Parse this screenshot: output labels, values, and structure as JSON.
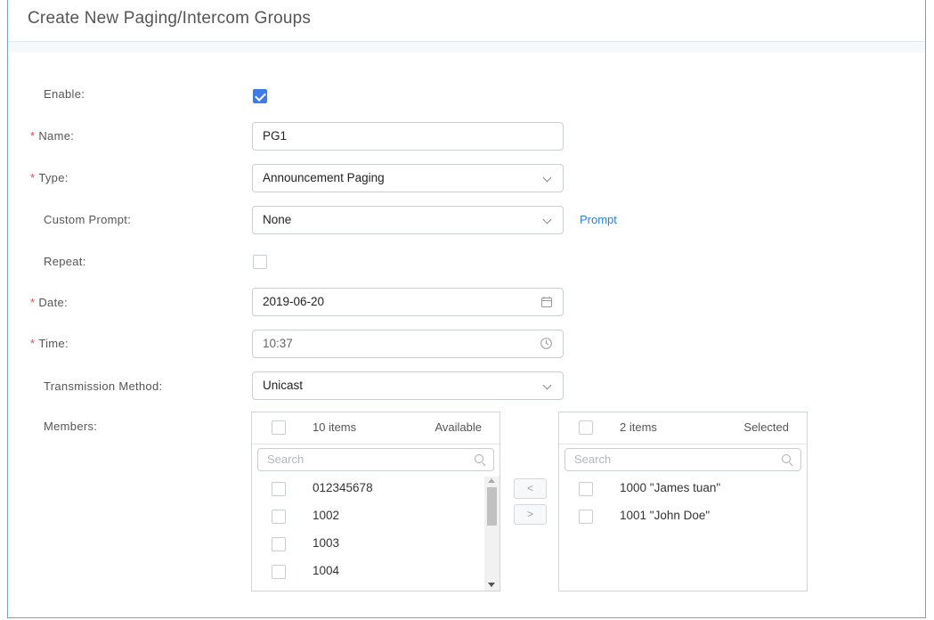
{
  "header": {
    "title": "Create New Paging/Intercom Groups"
  },
  "form": {
    "enable": {
      "label": "Enable:",
      "checked": true
    },
    "name": {
      "label": "Name:",
      "required_mark": "*",
      "value": "PG1"
    },
    "type": {
      "label": "Type:",
      "required_mark": "*",
      "value": "Announcement Paging"
    },
    "custom_prompt": {
      "label": "Custom Prompt:",
      "value": "None",
      "link": "Prompt"
    },
    "repeat": {
      "label": "Repeat:",
      "checked": false
    },
    "date": {
      "label": "Date:",
      "required_mark": "*",
      "value": "2019-06-20"
    },
    "time": {
      "label": "Time:",
      "required_mark": "*",
      "value": "10:37"
    },
    "transmission": {
      "label": "Transmission Method:",
      "value": "Unicast"
    },
    "members": {
      "label": "Members:"
    }
  },
  "available": {
    "count": "10 items",
    "title": "Available",
    "search_placeholder": "Search",
    "items": [
      "012345678",
      "1002",
      "1003",
      "1004"
    ]
  },
  "selected": {
    "count": "2 items",
    "title": "Selected",
    "search_placeholder": "Search",
    "items": [
      "1000 \"James tuan\"",
      "1001 \"John Doe\""
    ]
  },
  "transfer": {
    "left": "<",
    "right": ">"
  },
  "icons": [
    "check-icon",
    "chevron-down-icon",
    "calendar-icon",
    "clock-icon",
    "search-icon"
  ]
}
